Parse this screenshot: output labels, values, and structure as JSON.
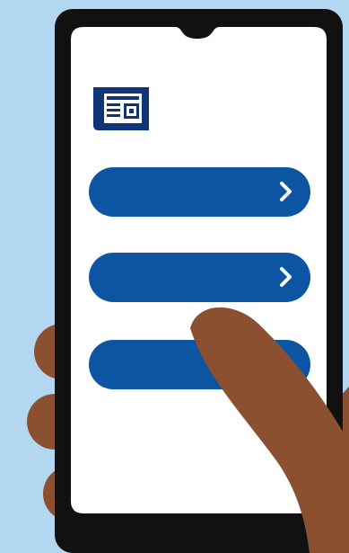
{
  "colors": {
    "background": "#b3d7f0",
    "phone_frame": "#111111",
    "screen": "#ffffff",
    "button_fill": "#0b55a3",
    "news_icon": "#0f3578",
    "skin": "#8a5030"
  },
  "screen": {
    "icon": "news-icon",
    "menu_buttons": [
      {
        "icon": "chevron-right-icon"
      },
      {
        "icon": "chevron-right-icon"
      },
      {
        "icon": "chevron-right-icon"
      }
    ]
  }
}
